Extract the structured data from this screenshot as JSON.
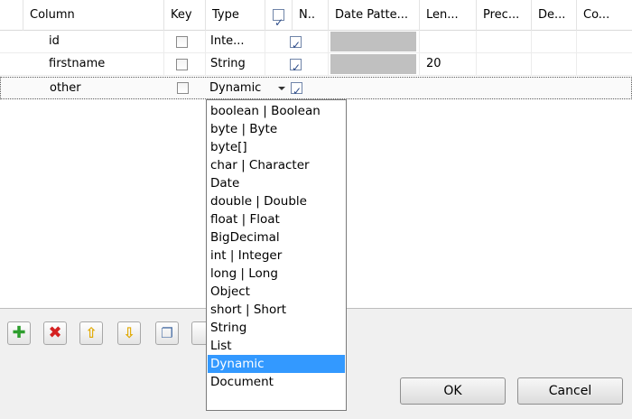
{
  "headers": {
    "column": "Column",
    "key": "Key",
    "type": "Type",
    "nullable": "N..",
    "date_pattern": "Date Patte...",
    "length": "Len...",
    "precision": "Prec...",
    "default": "De...",
    "comment": "Co..."
  },
  "rows": [
    {
      "name": "id",
      "type": "Inte...",
      "length": "",
      "key": false,
      "nullable": true
    },
    {
      "name": "firstname",
      "type": "String",
      "length": "20",
      "key": false,
      "nullable": true
    },
    {
      "name": "other",
      "type": "Dynamic",
      "length": "",
      "key": false,
      "nullable": true
    }
  ],
  "type_options": [
    "boolean | Boolean",
    "byte | Byte",
    "byte[]",
    "char | Character",
    "Date",
    "double | Double",
    "float | Float",
    "BigDecimal",
    "int | Integer",
    "long | Long",
    "Object",
    "short | Short",
    "String",
    "List",
    "Dynamic",
    "Document"
  ],
  "selected_option": "Dynamic",
  "buttons": {
    "ok": "OK",
    "cancel": "Cancel"
  },
  "icons": [
    "add-icon",
    "delete-icon",
    "move-up-icon",
    "move-down-icon",
    "copy-icon"
  ],
  "colors": {
    "highlight": "#3399ff"
  }
}
